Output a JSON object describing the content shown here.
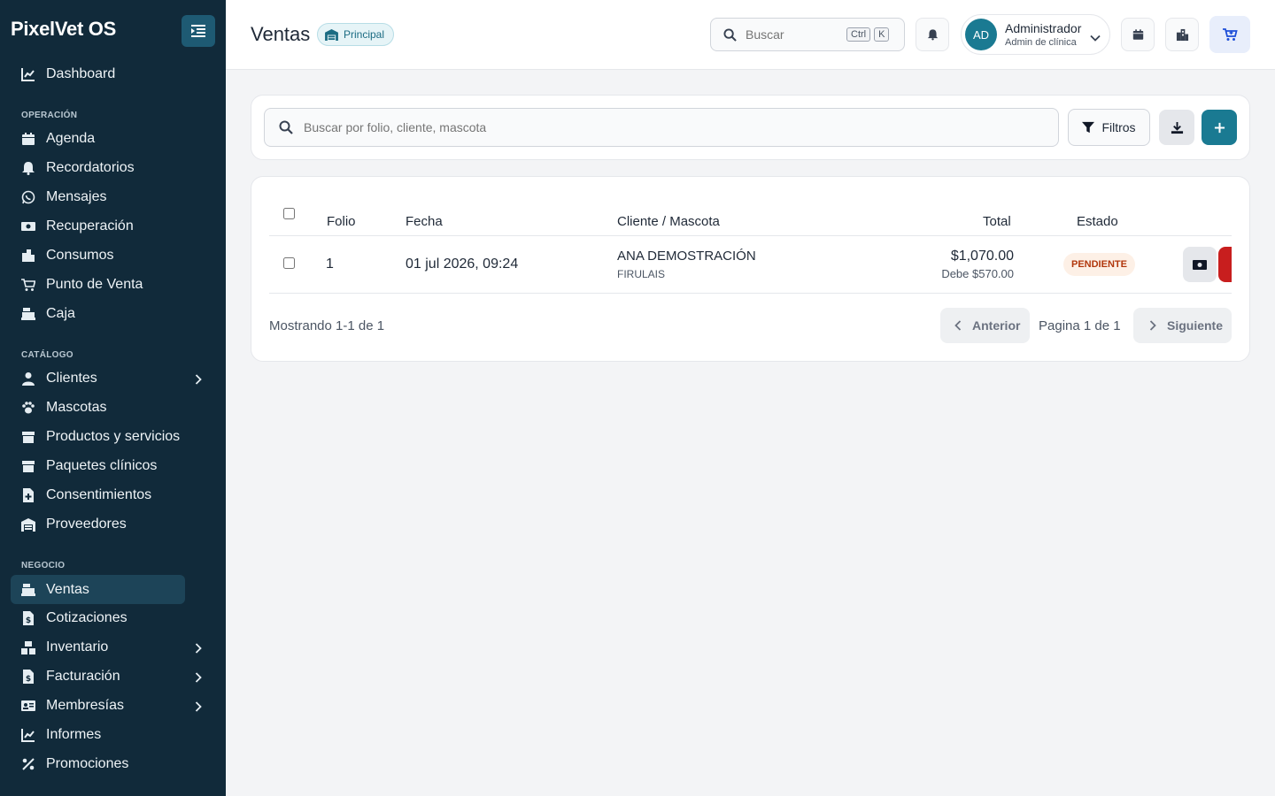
{
  "app": {
    "brand": "PixelVet OS"
  },
  "sidebar": {
    "dashboard": "Dashboard",
    "sections": {
      "operacion": "OPERACIÓN",
      "catalogo": "CATÁLOGO",
      "negocio": "NEGOCIO"
    },
    "items": {
      "agenda": "Agenda",
      "recordatorios": "Recordatorios",
      "mensajes": "Mensajes",
      "recuperacion": "Recuperación",
      "consumos": "Consumos",
      "punto_venta": "Punto de Venta",
      "caja": "Caja",
      "clientes": "Clientes",
      "mascotas": "Mascotas",
      "productos": "Productos y servicios",
      "paquetes": "Paquetes clínicos",
      "consentimientos": "Consentimientos",
      "proveedores": "Proveedores",
      "ventas": "Ventas",
      "cotizaciones": "Cotizaciones",
      "inventario": "Inventario",
      "facturacion": "Facturación",
      "membresias": "Membresías",
      "informes": "Informes",
      "promociones": "Promociones"
    }
  },
  "header": {
    "title": "Ventas",
    "branch": "Principal",
    "search_placeholder": "Buscar",
    "kbd_ctrl": "Ctrl",
    "kbd_k": "K",
    "user": {
      "initials": "AD",
      "name": "Administrador",
      "role": "Admin de clínica"
    }
  },
  "toolbar": {
    "search_placeholder": "Buscar por folio, cliente, mascota",
    "filters_label": "Filtros"
  },
  "table": {
    "headers": {
      "folio": "Folio",
      "fecha": "Fecha",
      "cliente": "Cliente / Mascota",
      "total": "Total",
      "estado": "Estado"
    },
    "rows": [
      {
        "folio": "1",
        "fecha": "01 jul 2026, 09:24",
        "cliente": "ANA DEMOSTRACIÓN",
        "mascota": "FIRULAIS",
        "total": "$1,070.00",
        "debe": "Debe $570.00",
        "estado": "PENDIENTE"
      }
    ]
  },
  "pagination": {
    "summary": "Mostrando 1-1 de 1",
    "prev": "Anterior",
    "page": "Pagina 1 de 1",
    "next": "Siguiente"
  },
  "colors": {
    "sidebar_bg": "#112a3a",
    "accent": "#1a7a92",
    "danger": "#c81e1e",
    "pending_text": "#b1370c"
  }
}
